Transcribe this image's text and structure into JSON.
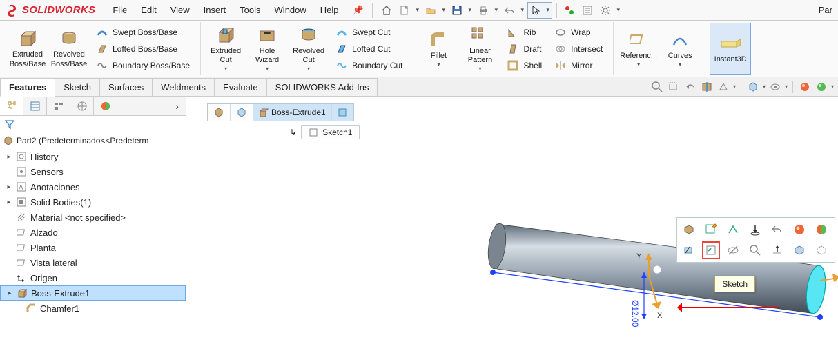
{
  "app_title": "SOLIDWORKS",
  "top_right_label": "Par",
  "menu": {
    "file": "File",
    "edit": "Edit",
    "view": "View",
    "insert": "Insert",
    "tools": "Tools",
    "window": "Window",
    "help": "Help"
  },
  "ribbon": {
    "extruded_boss": "Extruded Boss/Base",
    "revolved_boss": "Revolved Boss/Base",
    "swept_boss": "Swept Boss/Base",
    "lofted_boss": "Lofted Boss/Base",
    "boundary_boss": "Boundary Boss/Base",
    "extruded_cut": "Extruded Cut",
    "hole_wizard": "Hole Wizard",
    "revolved_cut": "Revolved Cut",
    "swept_cut": "Swept Cut",
    "lofted_cut": "Lofted Cut",
    "boundary_cut": "Boundary Cut",
    "fillet": "Fillet",
    "linear_pattern": "Linear Pattern",
    "rib": "Rib",
    "draft": "Draft",
    "shell": "Shell",
    "wrap": "Wrap",
    "intersect": "Intersect",
    "mirror": "Mirror",
    "reference": "Referenc...",
    "curves": "Curves",
    "instant3d": "Instant3D"
  },
  "tabs": {
    "features": "Features",
    "sketch": "Sketch",
    "surfaces": "Surfaces",
    "weldments": "Weldments",
    "evaluate": "Evaluate",
    "addins": "SOLIDWORKS Add-Ins"
  },
  "tree": {
    "root": "Part2  (Predeterminado<<Predeterm",
    "history": "History",
    "sensors": "Sensors",
    "anotaciones": "Anotaciones",
    "solid_bodies": "Solid Bodies(1)",
    "material": "Material <not specified>",
    "alzado": "Alzado",
    "planta": "Planta",
    "vista_lateral": "Vista lateral",
    "origen": "Origen",
    "boss_extrude1": "Boss-Extrude1",
    "chamfer1": "Chamfer1"
  },
  "breadcrumb": {
    "boss_extrude1": "Boss-Extrude1",
    "sketch1": "Sketch1"
  },
  "context_tooltip": "Sketch",
  "viewport": {
    "axis_x": "X",
    "axis_y": "Y",
    "dimension": "Ø12.00"
  }
}
